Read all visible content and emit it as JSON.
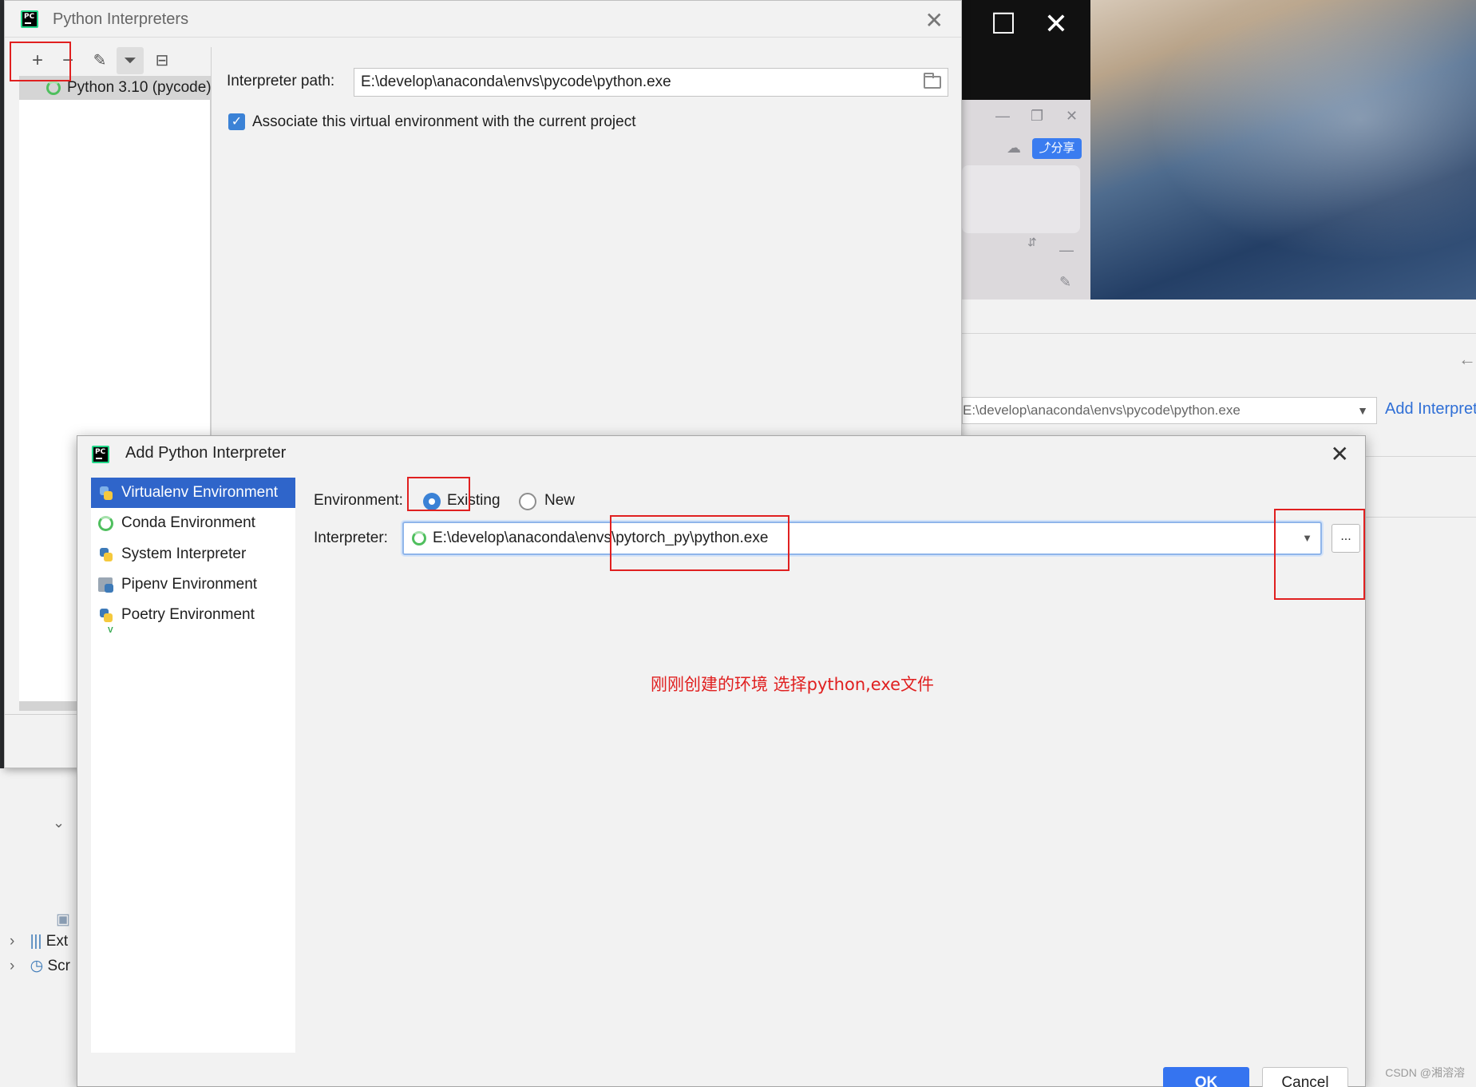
{
  "background": {
    "qq_share_label": "分享",
    "combo_value": "E:\\develop\\anaconda\\envs\\pycode\\python.exe",
    "add_interpreter_link": "Add Interpreter",
    "left_rows": [
      "Ext",
      "Scr"
    ],
    "watermark": "CSDN @湘溶溶"
  },
  "interpreters_dialog": {
    "title": "Python Interpreters",
    "list_items": [
      "Python 3.10 (pycode)"
    ],
    "interpreter_path_label": "Interpreter path:",
    "interpreter_path_value": "E:\\develop\\anaconda\\envs\\pycode\\python.exe",
    "associate_label": "Associate this virtual environment with the current project",
    "associate_checked": true
  },
  "add_dialog": {
    "title": "Add Python Interpreter",
    "nav": [
      {
        "label": "Virtualenv Environment",
        "selected": true
      },
      {
        "label": "Conda Environment",
        "selected": false
      },
      {
        "label": "System Interpreter",
        "selected": false
      },
      {
        "label": "Pipenv Environment",
        "selected": false
      },
      {
        "label": "Poetry Environment",
        "selected": false
      }
    ],
    "environment_label": "Environment:",
    "env_options": [
      "Existing",
      "New"
    ],
    "env_selected": "Existing",
    "interpreter_label": "Interpreter:",
    "interpreter_value": "E:\\develop\\anaconda\\envs\\pytorch_py\\python.exe",
    "browse_label": "...",
    "annotation": "刚刚创建的环境  选择python,exe文件",
    "ok_label": "OK",
    "cancel_label": "Cancel"
  },
  "colors": {
    "accent": "#3574f0",
    "selection": "#2f65ca",
    "annotation_red": "#e02020"
  }
}
